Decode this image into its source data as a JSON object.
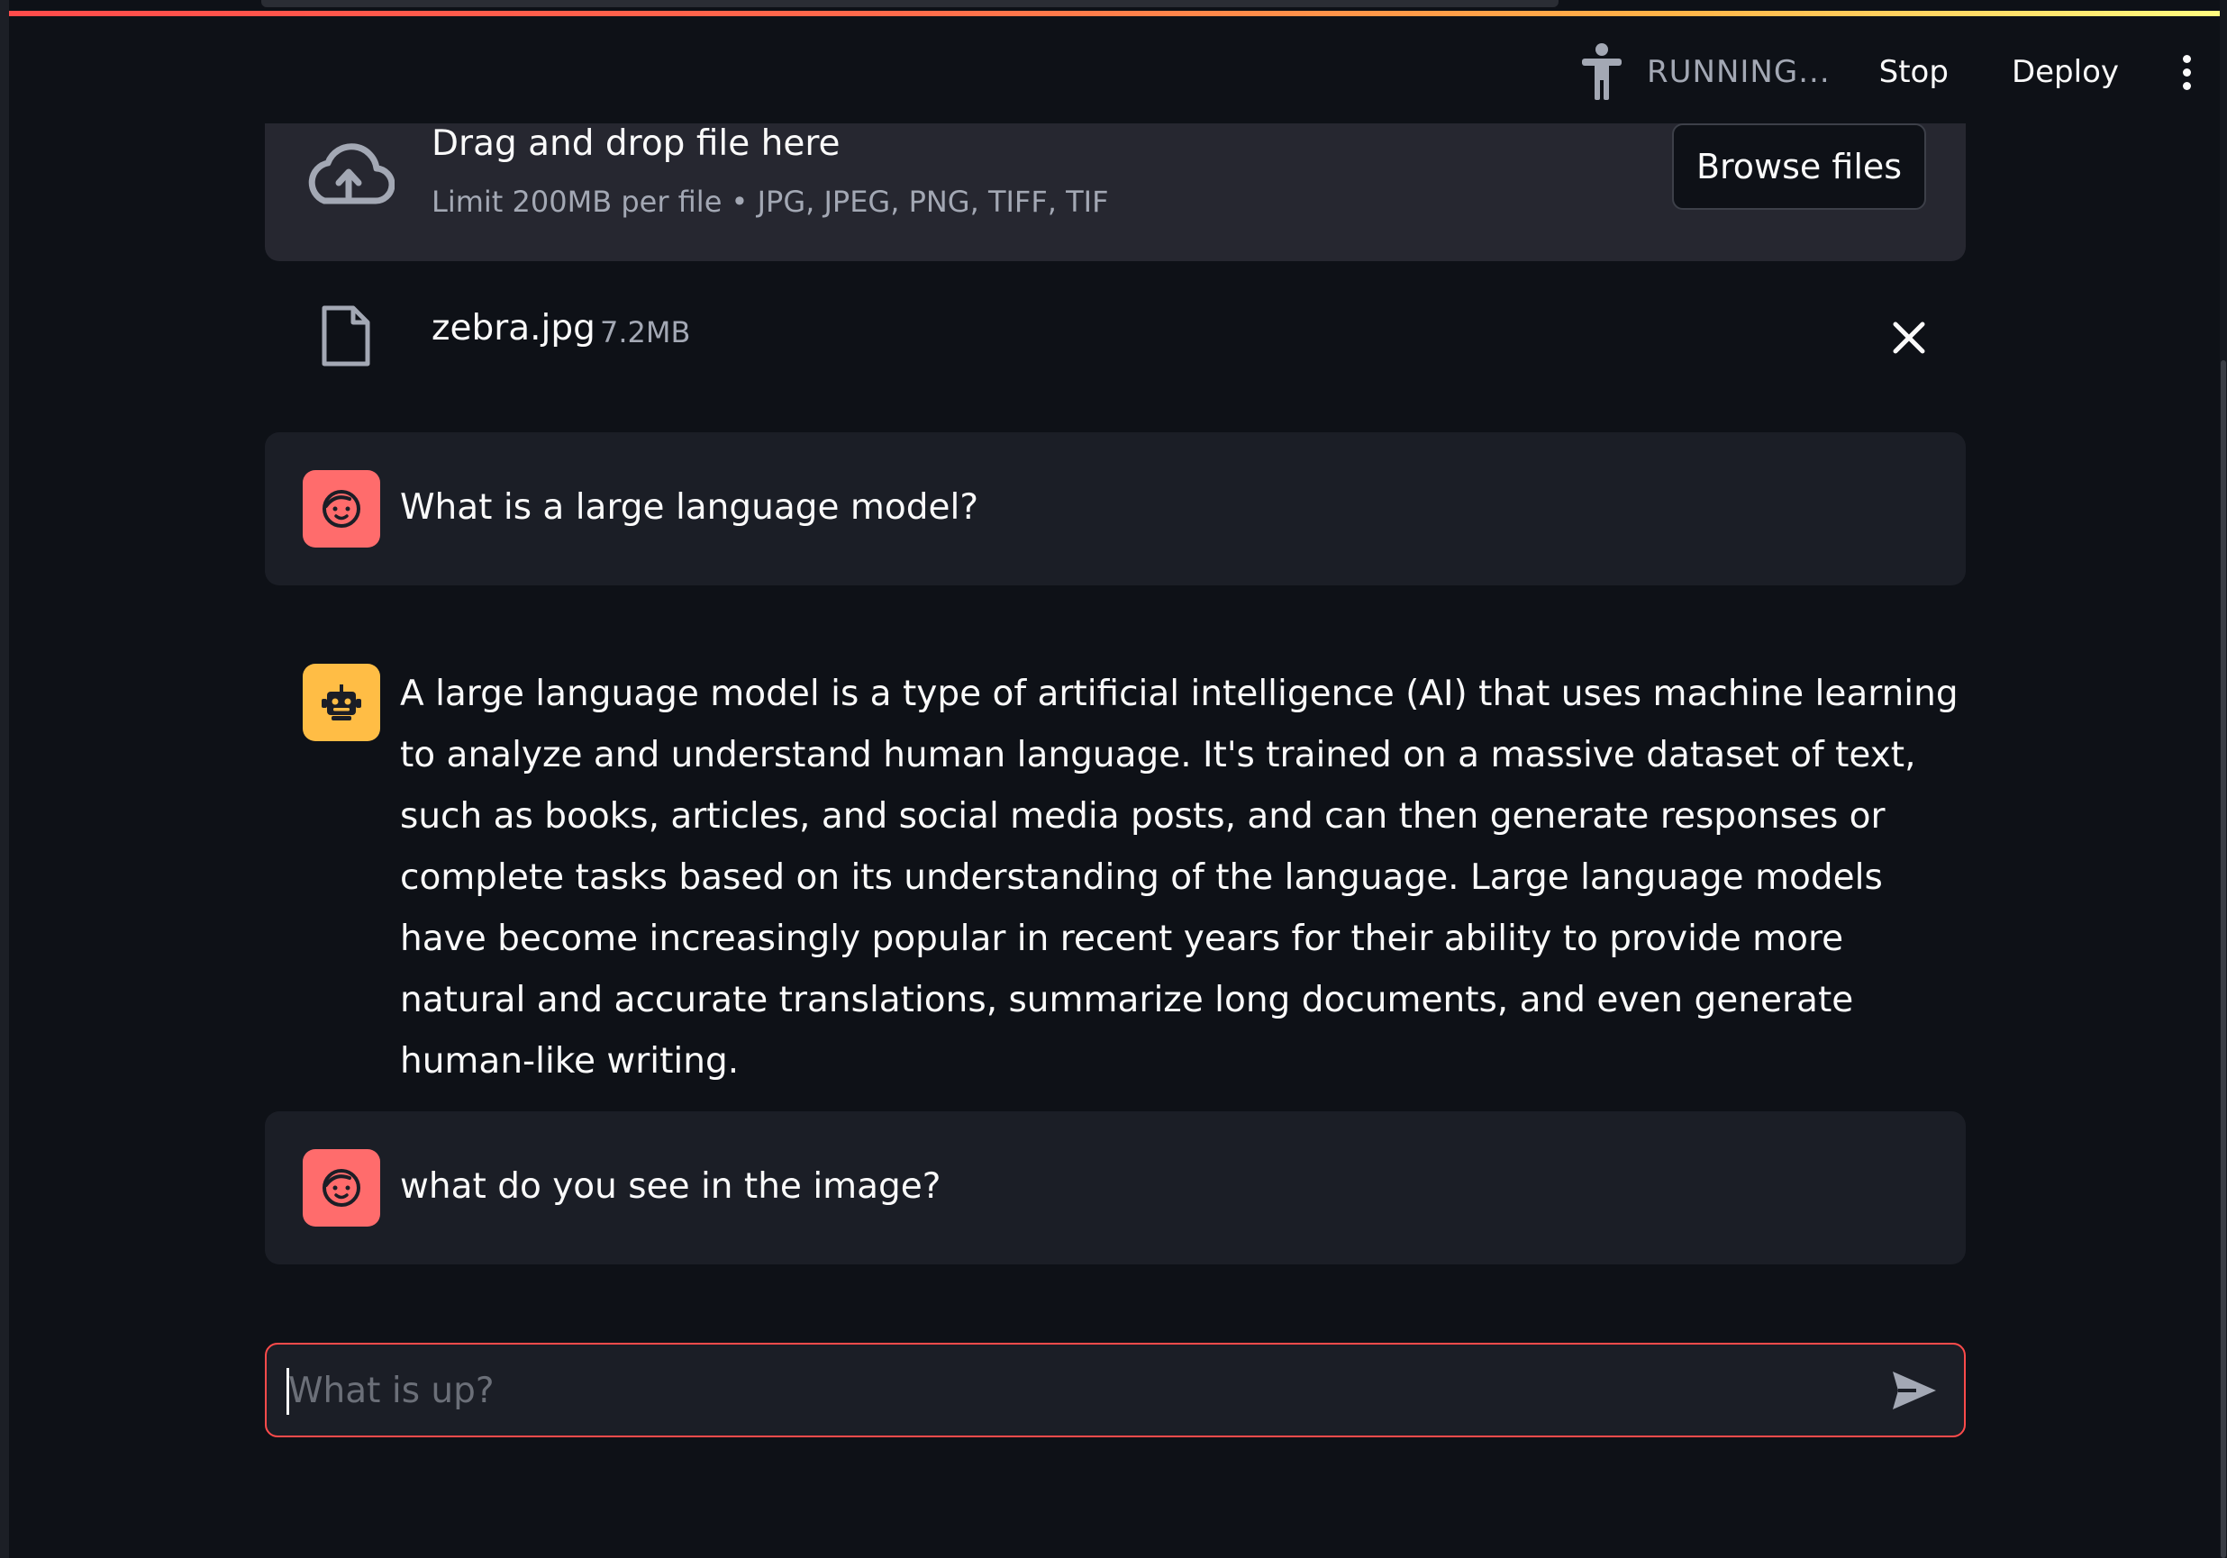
{
  "header": {
    "status": "RUNNING...",
    "stop_label": "Stop",
    "deploy_label": "Deploy"
  },
  "uploader": {
    "title": "Drag and drop file here",
    "subtitle": "Limit 200MB per file • JPG, JPEG, PNG, TIFF, TIF",
    "browse_label": "Browse files"
  },
  "file": {
    "name": "zebra.jpg",
    "size": "7.2MB"
  },
  "messages": [
    {
      "role": "user",
      "text": "What is a large language model?"
    },
    {
      "role": "assistant",
      "text": "A large language model is a type of artificial intelligence (AI) that uses machine learning to analyze and understand human language. It's trained on a massive dataset of text, such as books, articles, and social media posts, and can then generate responses or complete tasks based on its understanding of the language. Large language models have become increasingly popular in recent years for their ability to provide more natural and accurate translations, summarize long documents, and even generate human-like writing."
    },
    {
      "role": "user",
      "text": "what do you see in the image?"
    }
  ],
  "chat_input": {
    "placeholder": "What is up?"
  },
  "icons": {
    "status": "running-person-icon",
    "menu": "kebab-menu-icon",
    "upload": "cloud-upload-icon",
    "file": "file-icon",
    "remove": "close-icon",
    "user_avatar": "user-face-icon",
    "bot_avatar": "robot-icon",
    "send": "send-icon"
  },
  "colors": {
    "background": "#0e1117",
    "accent": "#ff4b4b",
    "user_avatar": "#ff6c6c",
    "bot_avatar": "#ffbd45"
  }
}
